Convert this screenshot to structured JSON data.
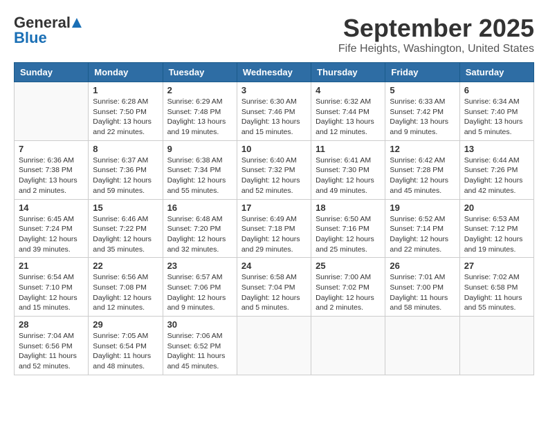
{
  "header": {
    "logo": {
      "part1": "General",
      "part2": "Blue"
    },
    "title": "September 2025",
    "location": "Fife Heights, Washington, United States"
  },
  "days_of_week": [
    "Sunday",
    "Monday",
    "Tuesday",
    "Wednesday",
    "Thursday",
    "Friday",
    "Saturday"
  ],
  "weeks": [
    [
      {
        "day": "",
        "sunrise": "",
        "sunset": "",
        "daylight": ""
      },
      {
        "day": "1",
        "sunrise": "Sunrise: 6:28 AM",
        "sunset": "Sunset: 7:50 PM",
        "daylight": "Daylight: 13 hours and 22 minutes."
      },
      {
        "day": "2",
        "sunrise": "Sunrise: 6:29 AM",
        "sunset": "Sunset: 7:48 PM",
        "daylight": "Daylight: 13 hours and 19 minutes."
      },
      {
        "day": "3",
        "sunrise": "Sunrise: 6:30 AM",
        "sunset": "Sunset: 7:46 PM",
        "daylight": "Daylight: 13 hours and 15 minutes."
      },
      {
        "day": "4",
        "sunrise": "Sunrise: 6:32 AM",
        "sunset": "Sunset: 7:44 PM",
        "daylight": "Daylight: 13 hours and 12 minutes."
      },
      {
        "day": "5",
        "sunrise": "Sunrise: 6:33 AM",
        "sunset": "Sunset: 7:42 PM",
        "daylight": "Daylight: 13 hours and 9 minutes."
      },
      {
        "day": "6",
        "sunrise": "Sunrise: 6:34 AM",
        "sunset": "Sunset: 7:40 PM",
        "daylight": "Daylight: 13 hours and 5 minutes."
      }
    ],
    [
      {
        "day": "7",
        "sunrise": "Sunrise: 6:36 AM",
        "sunset": "Sunset: 7:38 PM",
        "daylight": "Daylight: 13 hours and 2 minutes."
      },
      {
        "day": "8",
        "sunrise": "Sunrise: 6:37 AM",
        "sunset": "Sunset: 7:36 PM",
        "daylight": "Daylight: 12 hours and 59 minutes."
      },
      {
        "day": "9",
        "sunrise": "Sunrise: 6:38 AM",
        "sunset": "Sunset: 7:34 PM",
        "daylight": "Daylight: 12 hours and 55 minutes."
      },
      {
        "day": "10",
        "sunrise": "Sunrise: 6:40 AM",
        "sunset": "Sunset: 7:32 PM",
        "daylight": "Daylight: 12 hours and 52 minutes."
      },
      {
        "day": "11",
        "sunrise": "Sunrise: 6:41 AM",
        "sunset": "Sunset: 7:30 PM",
        "daylight": "Daylight: 12 hours and 49 minutes."
      },
      {
        "day": "12",
        "sunrise": "Sunrise: 6:42 AM",
        "sunset": "Sunset: 7:28 PM",
        "daylight": "Daylight: 12 hours and 45 minutes."
      },
      {
        "day": "13",
        "sunrise": "Sunrise: 6:44 AM",
        "sunset": "Sunset: 7:26 PM",
        "daylight": "Daylight: 12 hours and 42 minutes."
      }
    ],
    [
      {
        "day": "14",
        "sunrise": "Sunrise: 6:45 AM",
        "sunset": "Sunset: 7:24 PM",
        "daylight": "Daylight: 12 hours and 39 minutes."
      },
      {
        "day": "15",
        "sunrise": "Sunrise: 6:46 AM",
        "sunset": "Sunset: 7:22 PM",
        "daylight": "Daylight: 12 hours and 35 minutes."
      },
      {
        "day": "16",
        "sunrise": "Sunrise: 6:48 AM",
        "sunset": "Sunset: 7:20 PM",
        "daylight": "Daylight: 12 hours and 32 minutes."
      },
      {
        "day": "17",
        "sunrise": "Sunrise: 6:49 AM",
        "sunset": "Sunset: 7:18 PM",
        "daylight": "Daylight: 12 hours and 29 minutes."
      },
      {
        "day": "18",
        "sunrise": "Sunrise: 6:50 AM",
        "sunset": "Sunset: 7:16 PM",
        "daylight": "Daylight: 12 hours and 25 minutes."
      },
      {
        "day": "19",
        "sunrise": "Sunrise: 6:52 AM",
        "sunset": "Sunset: 7:14 PM",
        "daylight": "Daylight: 12 hours and 22 minutes."
      },
      {
        "day": "20",
        "sunrise": "Sunrise: 6:53 AM",
        "sunset": "Sunset: 7:12 PM",
        "daylight": "Daylight: 12 hours and 19 minutes."
      }
    ],
    [
      {
        "day": "21",
        "sunrise": "Sunrise: 6:54 AM",
        "sunset": "Sunset: 7:10 PM",
        "daylight": "Daylight: 12 hours and 15 minutes."
      },
      {
        "day": "22",
        "sunrise": "Sunrise: 6:56 AM",
        "sunset": "Sunset: 7:08 PM",
        "daylight": "Daylight: 12 hours and 12 minutes."
      },
      {
        "day": "23",
        "sunrise": "Sunrise: 6:57 AM",
        "sunset": "Sunset: 7:06 PM",
        "daylight": "Daylight: 12 hours and 9 minutes."
      },
      {
        "day": "24",
        "sunrise": "Sunrise: 6:58 AM",
        "sunset": "Sunset: 7:04 PM",
        "daylight": "Daylight: 12 hours and 5 minutes."
      },
      {
        "day": "25",
        "sunrise": "Sunrise: 7:00 AM",
        "sunset": "Sunset: 7:02 PM",
        "daylight": "Daylight: 12 hours and 2 minutes."
      },
      {
        "day": "26",
        "sunrise": "Sunrise: 7:01 AM",
        "sunset": "Sunset: 7:00 PM",
        "daylight": "Daylight: 11 hours and 58 minutes."
      },
      {
        "day": "27",
        "sunrise": "Sunrise: 7:02 AM",
        "sunset": "Sunset: 6:58 PM",
        "daylight": "Daylight: 11 hours and 55 minutes."
      }
    ],
    [
      {
        "day": "28",
        "sunrise": "Sunrise: 7:04 AM",
        "sunset": "Sunset: 6:56 PM",
        "daylight": "Daylight: 11 hours and 52 minutes."
      },
      {
        "day": "29",
        "sunrise": "Sunrise: 7:05 AM",
        "sunset": "Sunset: 6:54 PM",
        "daylight": "Daylight: 11 hours and 48 minutes."
      },
      {
        "day": "30",
        "sunrise": "Sunrise: 7:06 AM",
        "sunset": "Sunset: 6:52 PM",
        "daylight": "Daylight: 11 hours and 45 minutes."
      },
      {
        "day": "",
        "sunrise": "",
        "sunset": "",
        "daylight": ""
      },
      {
        "day": "",
        "sunrise": "",
        "sunset": "",
        "daylight": ""
      },
      {
        "day": "",
        "sunrise": "",
        "sunset": "",
        "daylight": ""
      },
      {
        "day": "",
        "sunrise": "",
        "sunset": "",
        "daylight": ""
      }
    ]
  ]
}
